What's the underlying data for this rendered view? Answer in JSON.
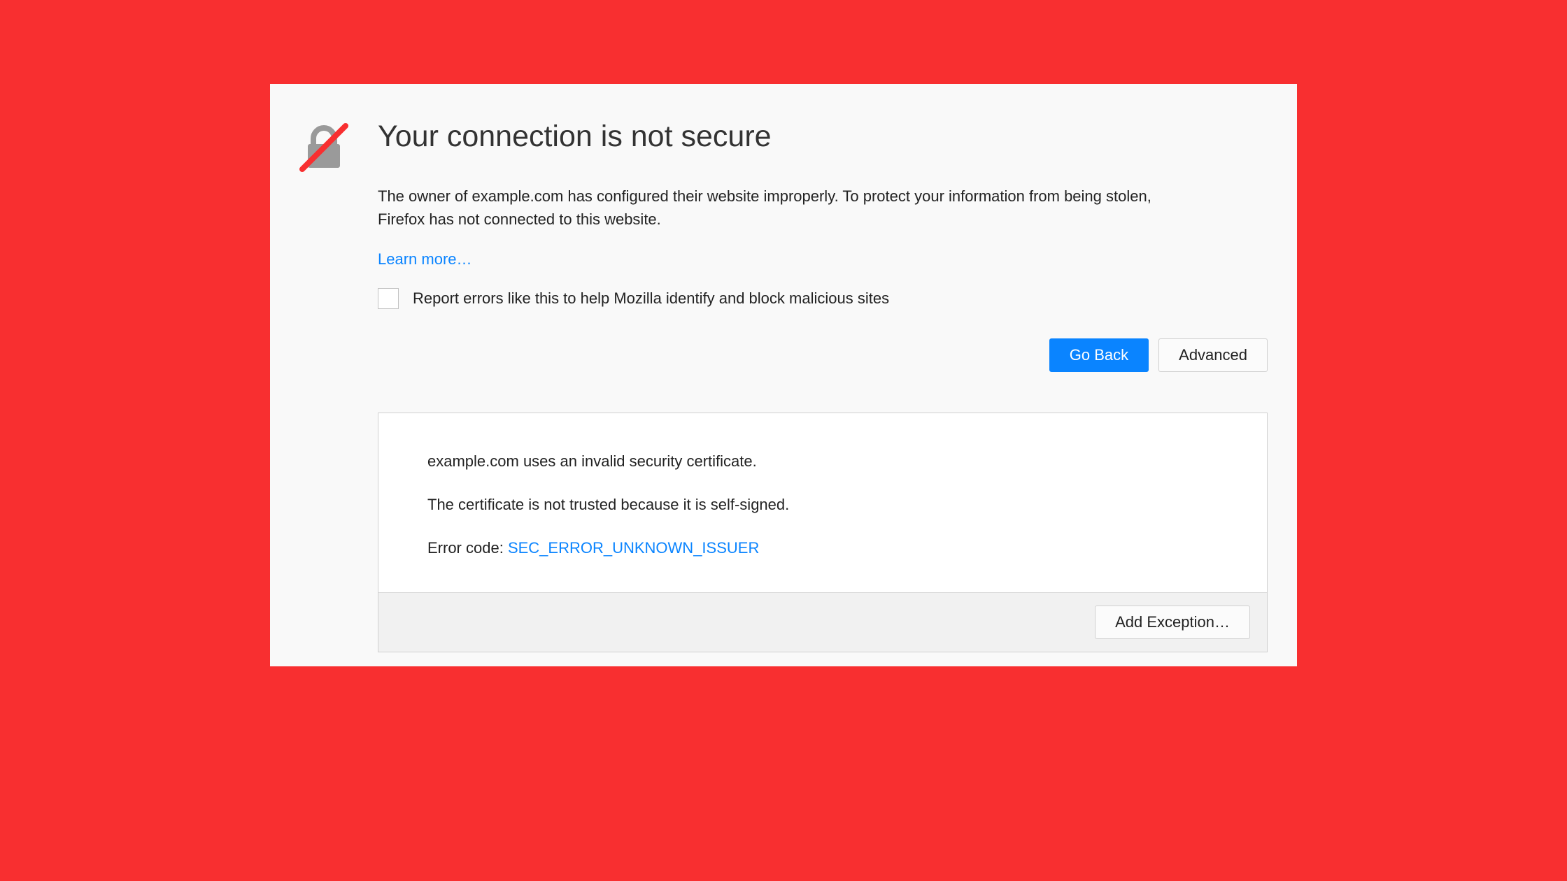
{
  "title": "Your connection is not secure",
  "description": "The owner of example.com has configured their website improperly. To protect your information from being stolen, Firefox has not connected to this website.",
  "learn_more": "Learn more…",
  "report_label": "Report errors like this to help Mozilla identify and block malicious sites",
  "buttons": {
    "go_back": "Go Back",
    "advanced": "Advanced",
    "add_exception": "Add Exception…"
  },
  "cert": {
    "line1": "example.com uses an invalid security certificate.",
    "line2": "The certificate is not trusted because it is self-signed.",
    "error_code_label": "Error code: ",
    "error_code": "SEC_ERROR_UNKNOWN_ISSUER"
  },
  "colors": {
    "background": "#f82f30",
    "panel": "#f9f9f9",
    "link": "#0a84ff",
    "primary_button": "#0a84ff"
  }
}
